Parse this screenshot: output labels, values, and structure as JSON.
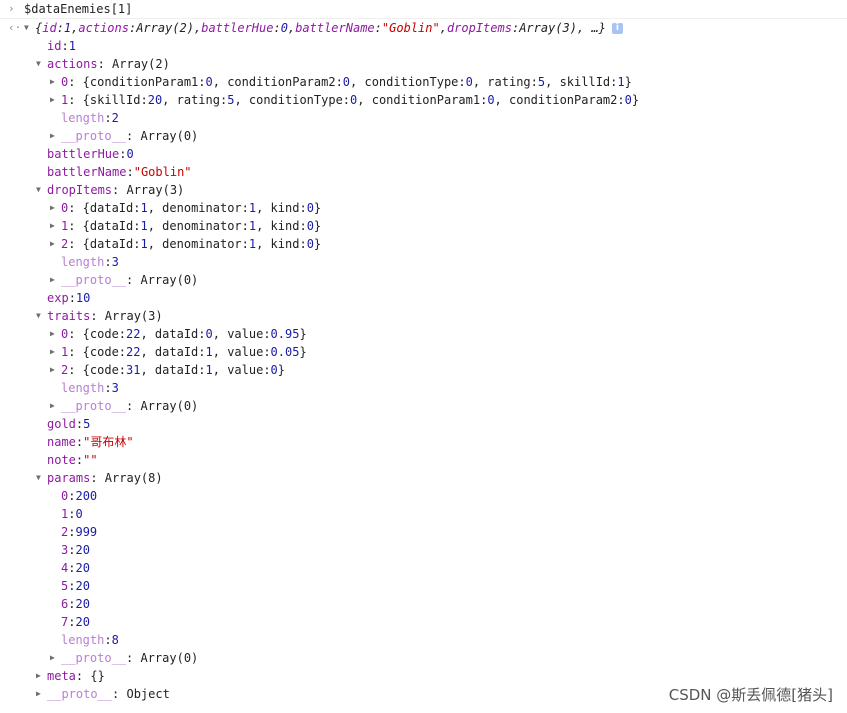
{
  "console": {
    "input_prompt": "›",
    "input": "$dataEnemies[1]",
    "output_prompt": "‹·",
    "lines": [
      {
        "indent": 0,
        "toggle": "open",
        "segs": [
          [
            "i",
            "{"
          ],
          [
            "ik",
            "id"
          ],
          [
            "i",
            ": "
          ],
          [
            "in",
            "1"
          ],
          [
            "i",
            ", "
          ],
          [
            "ik",
            "actions"
          ],
          [
            "i",
            ": "
          ],
          [
            "i",
            "Array(2)"
          ],
          [
            "i",
            ", "
          ],
          [
            "ik",
            "battlerHue"
          ],
          [
            "i",
            ": "
          ],
          [
            "in",
            "0"
          ],
          [
            "i",
            ", "
          ],
          [
            "ik",
            "battlerName"
          ],
          [
            "i",
            ": "
          ],
          [
            "is",
            "\"Goblin\""
          ],
          [
            "i",
            ", "
          ],
          [
            "ik",
            "dropItems"
          ],
          [
            "i",
            ": "
          ],
          [
            "i",
            "Array(3)"
          ],
          [
            "i",
            ", …}"
          ]
        ],
        "info": true
      },
      {
        "indent": 1,
        "toggle": "none",
        "segs": [
          [
            "k",
            "id"
          ],
          [
            "p",
            ": "
          ],
          [
            "n",
            "1"
          ]
        ]
      },
      {
        "indent": 1,
        "toggle": "open",
        "segs": [
          [
            "k",
            "actions"
          ],
          [
            "p",
            ": Array(2)"
          ]
        ]
      },
      {
        "indent": 2,
        "toggle": "closed",
        "segs": [
          [
            "k",
            "0"
          ],
          [
            "p",
            ": {conditionParam1: "
          ],
          [
            "n",
            "0"
          ],
          [
            "p",
            ", conditionParam2: "
          ],
          [
            "n",
            "0"
          ],
          [
            "p",
            ", conditionType: "
          ],
          [
            "n",
            "0"
          ],
          [
            "p",
            ", rating: "
          ],
          [
            "n",
            "5"
          ],
          [
            "p",
            ", skillId: "
          ],
          [
            "n",
            "1"
          ],
          [
            "p",
            "}"
          ]
        ]
      },
      {
        "indent": 2,
        "toggle": "closed",
        "segs": [
          [
            "k",
            "1"
          ],
          [
            "p",
            ": {skillId: "
          ],
          [
            "n",
            "20"
          ],
          [
            "p",
            ", rating: "
          ],
          [
            "n",
            "5"
          ],
          [
            "p",
            ", conditionType: "
          ],
          [
            "n",
            "0"
          ],
          [
            "p",
            ", conditionParam1: "
          ],
          [
            "n",
            "0"
          ],
          [
            "p",
            ", conditionParam2: "
          ],
          [
            "n",
            "0"
          ],
          [
            "p",
            "}"
          ]
        ]
      },
      {
        "indent": 2,
        "toggle": "none",
        "segs": [
          [
            "kl",
            "length"
          ],
          [
            "p",
            ": "
          ],
          [
            "n",
            "2"
          ]
        ]
      },
      {
        "indent": 2,
        "toggle": "closed",
        "segs": [
          [
            "kp",
            "__proto__"
          ],
          [
            "p",
            ": Array(0)"
          ]
        ]
      },
      {
        "indent": 1,
        "toggle": "none",
        "segs": [
          [
            "k",
            "battlerHue"
          ],
          [
            "p",
            ": "
          ],
          [
            "n",
            "0"
          ]
        ]
      },
      {
        "indent": 1,
        "toggle": "none",
        "segs": [
          [
            "k",
            "battlerName"
          ],
          [
            "p",
            ": "
          ],
          [
            "s",
            "\"Goblin\""
          ]
        ]
      },
      {
        "indent": 1,
        "toggle": "open",
        "segs": [
          [
            "k",
            "dropItems"
          ],
          [
            "p",
            ": Array(3)"
          ]
        ]
      },
      {
        "indent": 2,
        "toggle": "closed",
        "segs": [
          [
            "k",
            "0"
          ],
          [
            "p",
            ": {dataId: "
          ],
          [
            "n",
            "1"
          ],
          [
            "p",
            ", denominator: "
          ],
          [
            "n",
            "1"
          ],
          [
            "p",
            ", kind: "
          ],
          [
            "n",
            "0"
          ],
          [
            "p",
            "}"
          ]
        ]
      },
      {
        "indent": 2,
        "toggle": "closed",
        "segs": [
          [
            "k",
            "1"
          ],
          [
            "p",
            ": {dataId: "
          ],
          [
            "n",
            "1"
          ],
          [
            "p",
            ", denominator: "
          ],
          [
            "n",
            "1"
          ],
          [
            "p",
            ", kind: "
          ],
          [
            "n",
            "0"
          ],
          [
            "p",
            "}"
          ]
        ]
      },
      {
        "indent": 2,
        "toggle": "closed",
        "segs": [
          [
            "k",
            "2"
          ],
          [
            "p",
            ": {dataId: "
          ],
          [
            "n",
            "1"
          ],
          [
            "p",
            ", denominator: "
          ],
          [
            "n",
            "1"
          ],
          [
            "p",
            ", kind: "
          ],
          [
            "n",
            "0"
          ],
          [
            "p",
            "}"
          ]
        ]
      },
      {
        "indent": 2,
        "toggle": "none",
        "segs": [
          [
            "kl",
            "length"
          ],
          [
            "p",
            ": "
          ],
          [
            "n",
            "3"
          ]
        ]
      },
      {
        "indent": 2,
        "toggle": "closed",
        "segs": [
          [
            "kp",
            "__proto__"
          ],
          [
            "p",
            ": Array(0)"
          ]
        ]
      },
      {
        "indent": 1,
        "toggle": "none",
        "segs": [
          [
            "k",
            "exp"
          ],
          [
            "p",
            ": "
          ],
          [
            "n",
            "10"
          ]
        ]
      },
      {
        "indent": 1,
        "toggle": "open",
        "segs": [
          [
            "k",
            "traits"
          ],
          [
            "p",
            ": Array(3)"
          ]
        ]
      },
      {
        "indent": 2,
        "toggle": "closed",
        "segs": [
          [
            "k",
            "0"
          ],
          [
            "p",
            ": {code: "
          ],
          [
            "n",
            "22"
          ],
          [
            "p",
            ", dataId: "
          ],
          [
            "n",
            "0"
          ],
          [
            "p",
            ", value: "
          ],
          [
            "n",
            "0.95"
          ],
          [
            "p",
            "}"
          ]
        ]
      },
      {
        "indent": 2,
        "toggle": "closed",
        "segs": [
          [
            "k",
            "1"
          ],
          [
            "p",
            ": {code: "
          ],
          [
            "n",
            "22"
          ],
          [
            "p",
            ", dataId: "
          ],
          [
            "n",
            "1"
          ],
          [
            "p",
            ", value: "
          ],
          [
            "n",
            "0.05"
          ],
          [
            "p",
            "}"
          ]
        ]
      },
      {
        "indent": 2,
        "toggle": "closed",
        "segs": [
          [
            "k",
            "2"
          ],
          [
            "p",
            ": {code: "
          ],
          [
            "n",
            "31"
          ],
          [
            "p",
            ", dataId: "
          ],
          [
            "n",
            "1"
          ],
          [
            "p",
            ", value: "
          ],
          [
            "n",
            "0"
          ],
          [
            "p",
            "}"
          ]
        ]
      },
      {
        "indent": 2,
        "toggle": "none",
        "segs": [
          [
            "kl",
            "length"
          ],
          [
            "p",
            ": "
          ],
          [
            "n",
            "3"
          ]
        ]
      },
      {
        "indent": 2,
        "toggle": "closed",
        "segs": [
          [
            "kp",
            "__proto__"
          ],
          [
            "p",
            ": Array(0)"
          ]
        ]
      },
      {
        "indent": 1,
        "toggle": "none",
        "segs": [
          [
            "k",
            "gold"
          ],
          [
            "p",
            ": "
          ],
          [
            "n",
            "5"
          ]
        ]
      },
      {
        "indent": 1,
        "toggle": "none",
        "segs": [
          [
            "k",
            "name"
          ],
          [
            "p",
            ": "
          ],
          [
            "s",
            "\"哥布林\""
          ]
        ]
      },
      {
        "indent": 1,
        "toggle": "none",
        "segs": [
          [
            "k",
            "note"
          ],
          [
            "p",
            ": "
          ],
          [
            "s",
            "\"\""
          ]
        ]
      },
      {
        "indent": 1,
        "toggle": "open",
        "segs": [
          [
            "k",
            "params"
          ],
          [
            "p",
            ": Array(8)"
          ]
        ]
      },
      {
        "indent": 2,
        "toggle": "none",
        "segs": [
          [
            "k",
            "0"
          ],
          [
            "p",
            ": "
          ],
          [
            "n",
            "200"
          ]
        ]
      },
      {
        "indent": 2,
        "toggle": "none",
        "segs": [
          [
            "k",
            "1"
          ],
          [
            "p",
            ": "
          ],
          [
            "n",
            "0"
          ]
        ]
      },
      {
        "indent": 2,
        "toggle": "none",
        "segs": [
          [
            "k",
            "2"
          ],
          [
            "p",
            ": "
          ],
          [
            "n",
            "999"
          ]
        ]
      },
      {
        "indent": 2,
        "toggle": "none",
        "segs": [
          [
            "k",
            "3"
          ],
          [
            "p",
            ": "
          ],
          [
            "n",
            "20"
          ]
        ]
      },
      {
        "indent": 2,
        "toggle": "none",
        "segs": [
          [
            "k",
            "4"
          ],
          [
            "p",
            ": "
          ],
          [
            "n",
            "20"
          ]
        ]
      },
      {
        "indent": 2,
        "toggle": "none",
        "segs": [
          [
            "k",
            "5"
          ],
          [
            "p",
            ": "
          ],
          [
            "n",
            "20"
          ]
        ]
      },
      {
        "indent": 2,
        "toggle": "none",
        "segs": [
          [
            "k",
            "6"
          ],
          [
            "p",
            ": "
          ],
          [
            "n",
            "20"
          ]
        ]
      },
      {
        "indent": 2,
        "toggle": "none",
        "segs": [
          [
            "k",
            "7"
          ],
          [
            "p",
            ": "
          ],
          [
            "n",
            "20"
          ]
        ]
      },
      {
        "indent": 2,
        "toggle": "none",
        "segs": [
          [
            "kl",
            "length"
          ],
          [
            "p",
            ": "
          ],
          [
            "n",
            "8"
          ]
        ]
      },
      {
        "indent": 2,
        "toggle": "closed",
        "segs": [
          [
            "kp",
            "__proto__"
          ],
          [
            "p",
            ": Array(0)"
          ]
        ]
      },
      {
        "indent": 1,
        "toggle": "closed",
        "segs": [
          [
            "k",
            "meta"
          ],
          [
            "p",
            ": {}"
          ]
        ]
      },
      {
        "indent": 1,
        "toggle": "closed",
        "segs": [
          [
            "kp",
            "__proto__"
          ],
          [
            "p",
            ": Object"
          ]
        ]
      }
    ]
  },
  "watermark": "CSDN @斯丢佩德[猪头]",
  "colors": {
    "key": "#8f1aa2",
    "number": "#1a1aa6",
    "string": "#c80000",
    "proto": "#b87fd3"
  }
}
